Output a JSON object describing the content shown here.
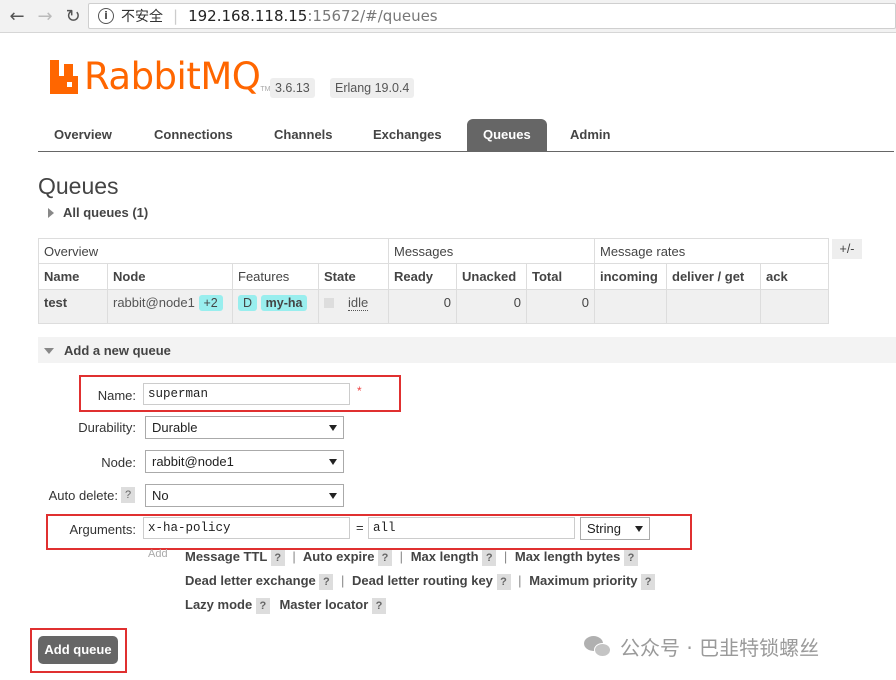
{
  "browser": {
    "back_icon": "arrow-left-icon",
    "forward_icon": "arrow-right-icon",
    "reload_icon": "reload-icon",
    "security_label": "不安全",
    "url_host": "192.168.118.15",
    "url_path": ":15672/#/queues"
  },
  "header": {
    "logo_text": "RabbitMQ",
    "logo_tm": "TM",
    "version": "3.6.13",
    "erlang": "Erlang 19.0.4"
  },
  "tabs": [
    {
      "label": "Overview",
      "active": false
    },
    {
      "label": "Connections",
      "active": false
    },
    {
      "label": "Channels",
      "active": false
    },
    {
      "label": "Exchanges",
      "active": false
    },
    {
      "label": "Queues",
      "active": true
    },
    {
      "label": "Admin",
      "active": false
    }
  ],
  "page_title": "Queues",
  "all_queues_label": "All queues (1)",
  "table": {
    "groups": [
      "Overview",
      "Messages",
      "Message rates"
    ],
    "plus_minus": "+/-",
    "columns": [
      "Name",
      "Node",
      "Features",
      "State",
      "Ready",
      "Unacked",
      "Total",
      "incoming",
      "deliver / get",
      "ack"
    ],
    "rows": [
      {
        "name": "test",
        "node": "rabbit@node1",
        "node_extra": "+2",
        "feature_1": "D",
        "feature_2": "my-ha",
        "state": "idle",
        "ready": "0",
        "unacked": "0",
        "total": "0",
        "incoming": "",
        "deliver_get": "",
        "ack": ""
      }
    ]
  },
  "add_queue": {
    "section_label": "Add a new queue",
    "name_label": "Name:",
    "name_value": "superman",
    "required_mark": "*",
    "durability_label": "Durability:",
    "durability_value": "Durable",
    "node_label": "Node:",
    "node_value": "rabbit@node1",
    "auto_delete_label": "Auto delete:",
    "auto_delete_help": "?",
    "auto_delete_value": "No",
    "arguments_label": "Arguments:",
    "arg_key": "x-ha-policy",
    "arg_equals": "=",
    "arg_value": "all",
    "arg_type": "String",
    "add_word": "Add",
    "hints": [
      [
        "Message TTL",
        "Auto expire",
        "Max length",
        "Max length bytes"
      ],
      [
        "Dead letter exchange",
        "Dead letter routing key",
        "Maximum priority"
      ],
      [
        "Lazy mode",
        "Master locator"
      ]
    ],
    "help_mark": "?",
    "hint_separator": "|",
    "submit_label": "Add queue"
  },
  "highlight_color": "#e03030",
  "accent_color": "#ff6600",
  "watermark": {
    "text": "公众号 · 巴韭特锁螺丝",
    "icon": "wechat-icon"
  }
}
